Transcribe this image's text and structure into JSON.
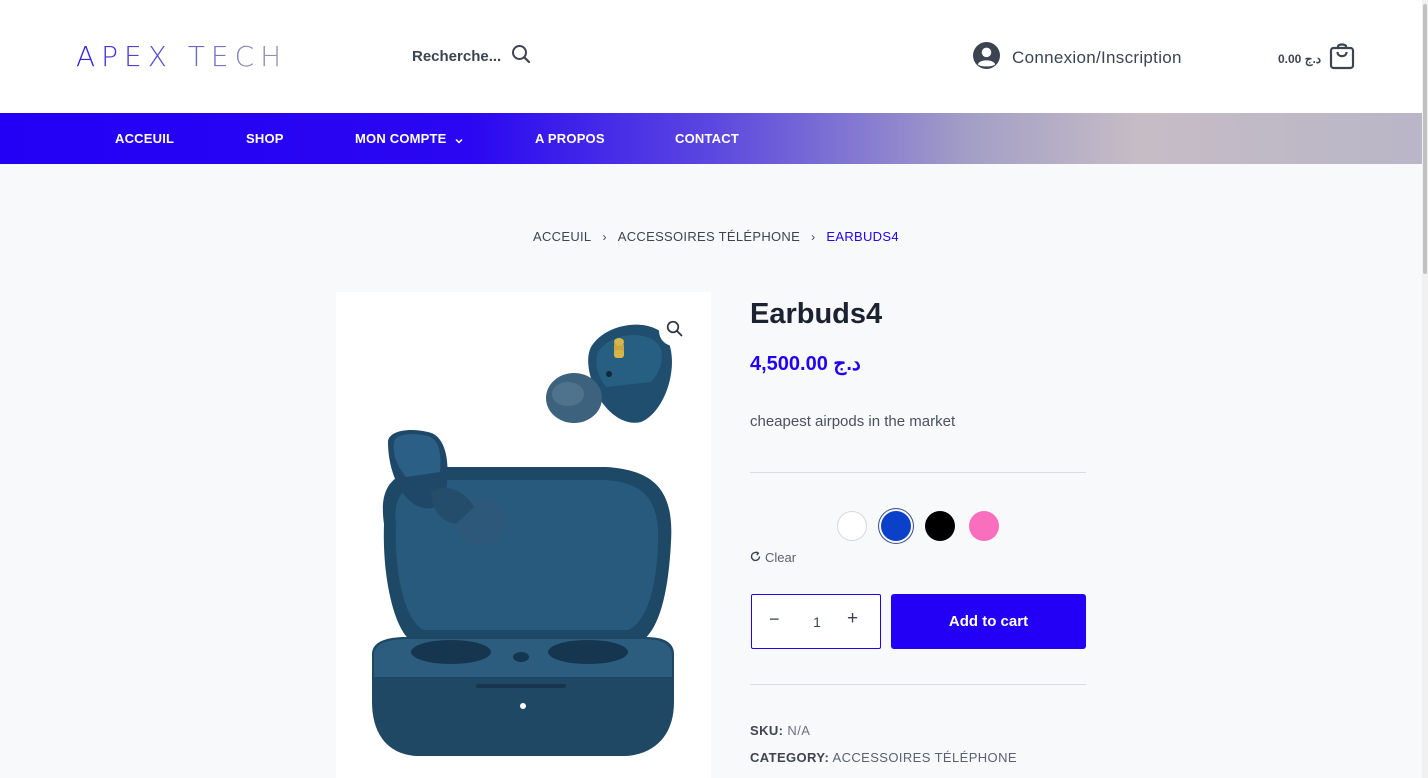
{
  "header": {
    "logo": "APEX TECH",
    "search_label": "Recherche...",
    "account_label": "Connexion/Inscription",
    "cart_total": "0.00 د.ج"
  },
  "nav": {
    "items": [
      "ACCEUIL",
      "SHOP",
      "MON COMPTE",
      "A PROPOS",
      "CONTACT"
    ]
  },
  "breadcrumb": {
    "home": "ACCEUIL",
    "category": "ACCESSOIRES TÉLÉPHONE",
    "current": "EARBUDS4"
  },
  "product": {
    "title": "Earbuds4",
    "price": "4,500.00 د.ج",
    "description": "cheapest airpods in the market",
    "swatches": [
      {
        "name": "white",
        "color": "#ffffff",
        "selected": false
      },
      {
        "name": "blue",
        "color": "#0b41c9",
        "selected": true
      },
      {
        "name": "black",
        "color": "#000000",
        "selected": false
      },
      {
        "name": "pink",
        "color": "#fa6fbd",
        "selected": false
      }
    ],
    "clear_label": "Clear",
    "quantity": "1",
    "add_to_cart_label": "Add to cart",
    "sku_label": "SKU:",
    "sku_value": "N/A",
    "category_label": "CATEGORY:",
    "category_value": "ACCESSOIRES TÉLÉPHONE"
  },
  "colors": {
    "accent": "#2300f5"
  }
}
